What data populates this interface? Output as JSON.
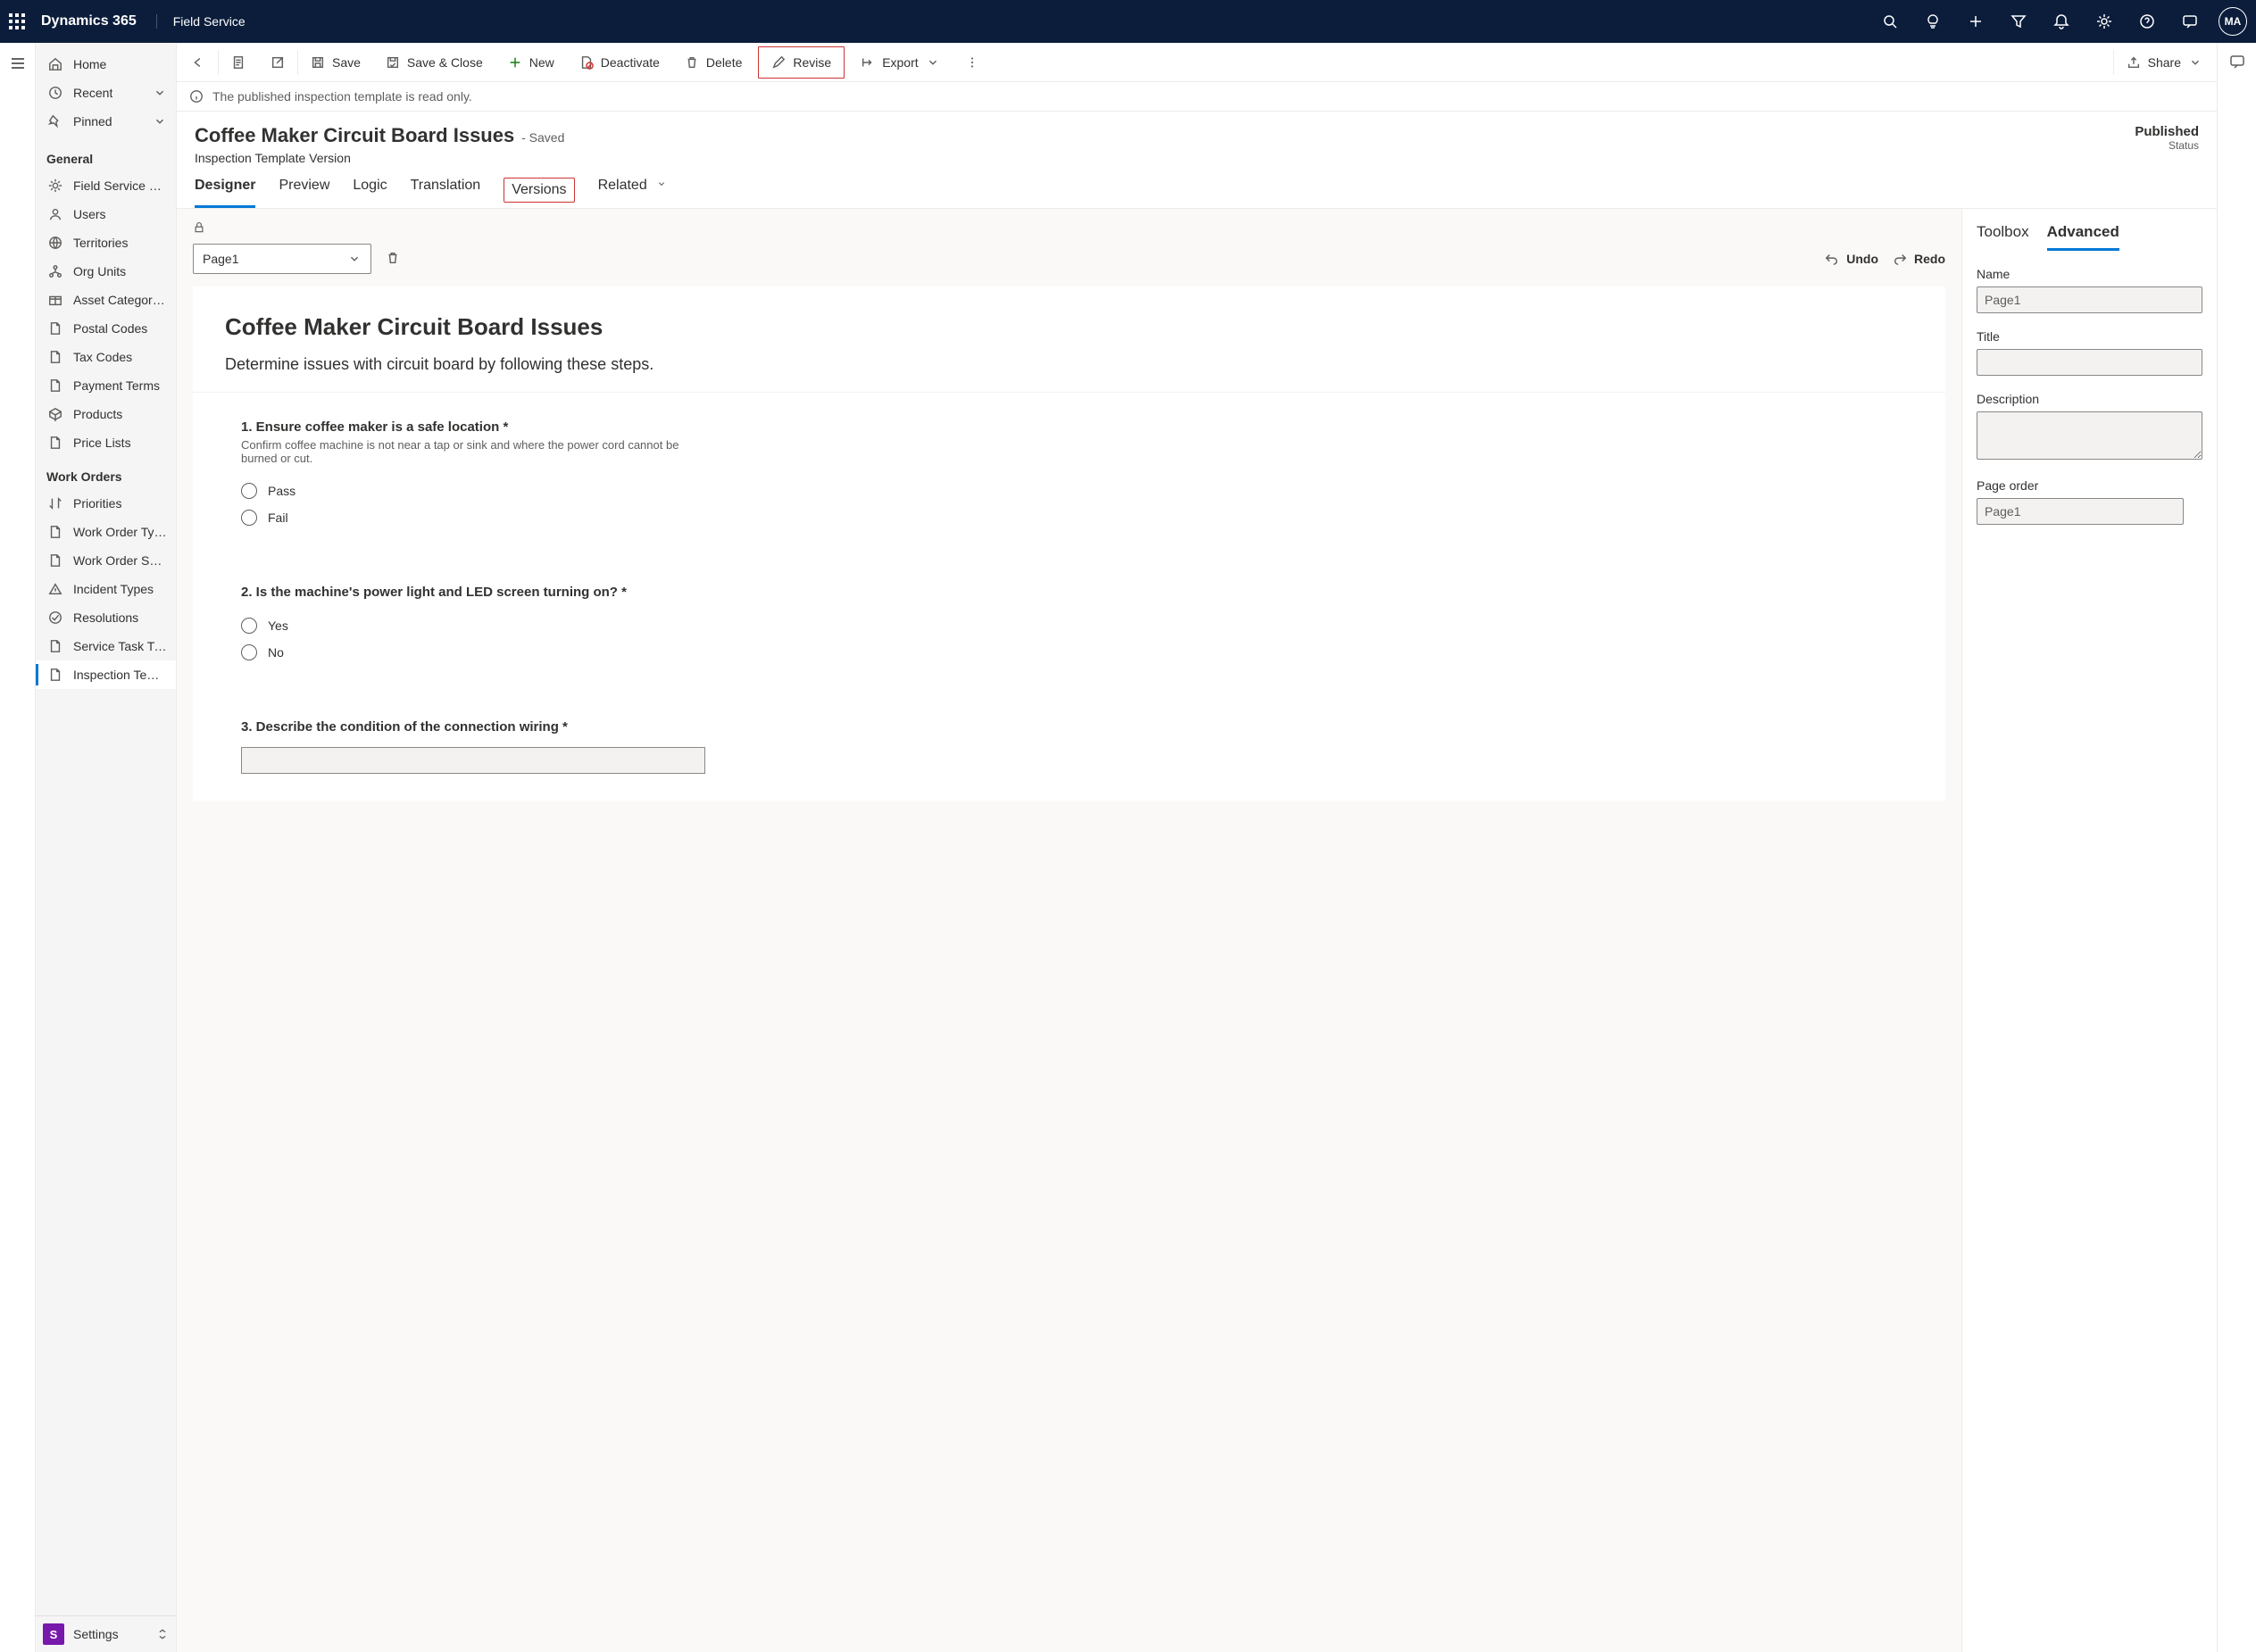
{
  "appbar": {
    "title": "Dynamics 365",
    "module": "Field Service",
    "avatar": "MA"
  },
  "sidebar": {
    "top": [
      {
        "label": "Home",
        "icon": "home"
      },
      {
        "label": "Recent",
        "icon": "clock",
        "chevron": true
      },
      {
        "label": "Pinned",
        "icon": "pin",
        "chevron": true
      }
    ],
    "groups": [
      {
        "header": "General",
        "items": [
          {
            "label": "Field Service Setti...",
            "icon": "gear"
          },
          {
            "label": "Users",
            "icon": "user"
          },
          {
            "label": "Territories",
            "icon": "globe"
          },
          {
            "label": "Org Units",
            "icon": "org"
          },
          {
            "label": "Asset Categories",
            "icon": "box"
          },
          {
            "label": "Postal Codes",
            "icon": "doc"
          },
          {
            "label": "Tax Codes",
            "icon": "doc"
          },
          {
            "label": "Payment Terms",
            "icon": "doc"
          },
          {
            "label": "Products",
            "icon": "cube"
          },
          {
            "label": "Price Lists",
            "icon": "doc"
          }
        ]
      },
      {
        "header": "Work Orders",
        "items": [
          {
            "label": "Priorities",
            "icon": "sort"
          },
          {
            "label": "Work Order Types",
            "icon": "doc"
          },
          {
            "label": "Work Order Subst...",
            "icon": "doc"
          },
          {
            "label": "Incident Types",
            "icon": "warn"
          },
          {
            "label": "Resolutions",
            "icon": "check"
          },
          {
            "label": "Service Task Types",
            "icon": "doc"
          },
          {
            "label": "Inspection Templa...",
            "icon": "doc",
            "active": true
          }
        ]
      }
    ],
    "settings": {
      "initial": "S",
      "label": "Settings"
    }
  },
  "commands": {
    "save": "Save",
    "save_close": "Save & Close",
    "new": "New",
    "deactivate": "Deactivate",
    "delete": "Delete",
    "revise": "Revise",
    "export": "Export",
    "share": "Share"
  },
  "infobar": "The published inspection template is read only.",
  "header": {
    "title": "Coffee Maker Circuit Board Issues",
    "saved": "- Saved",
    "subtitle": "Inspection Template Version",
    "status_value": "Published",
    "status_label": "Status"
  },
  "tabs": [
    "Designer",
    "Preview",
    "Logic",
    "Translation",
    "Versions",
    "Related"
  ],
  "designer": {
    "page_selector": "Page1",
    "undo": "Undo",
    "redo": "Redo",
    "canvas_title": "Coffee Maker Circuit Board Issues",
    "canvas_desc": "Determine issues with circuit board by following these steps.",
    "questions": [
      {
        "num": "1.",
        "title": "Ensure coffee maker is a safe location",
        "required": true,
        "desc": "Confirm coffee machine is not near a tap or sink and where the power cord cannot be burned or cut.",
        "type": "radio",
        "options": [
          "Pass",
          "Fail"
        ]
      },
      {
        "num": "2.",
        "title": "Is the machine's power light and LED screen turning on?",
        "required": true,
        "type": "radio",
        "options": [
          "Yes",
          "No"
        ]
      },
      {
        "num": "3.",
        "title": "Describe the condition of the connection wiring",
        "required": true,
        "type": "text"
      }
    ]
  },
  "props": {
    "tabs": [
      "Toolbox",
      "Advanced"
    ],
    "active_tab": "Advanced",
    "name_label": "Name",
    "name_value": "Page1",
    "title_label": "Title",
    "title_value": "",
    "desc_label": "Description",
    "desc_value": "",
    "order_label": "Page order",
    "order_value": "Page1"
  }
}
